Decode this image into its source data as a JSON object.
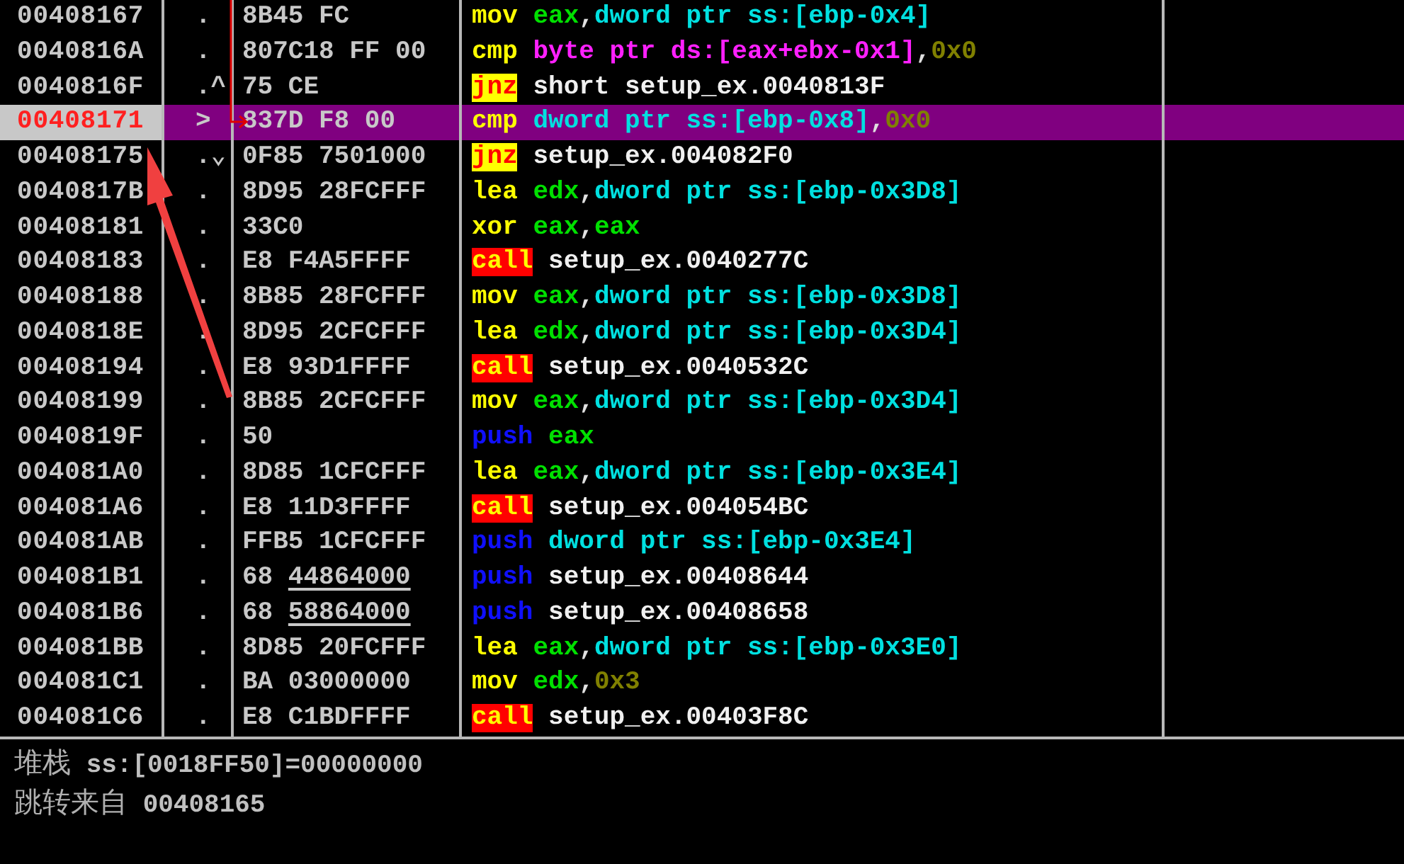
{
  "disassembly": {
    "rows": [
      {
        "address": "00408167",
        "marker": ".",
        "hex": "8B45 FC",
        "selected": false,
        "tokens": [
          {
            "kind": "mnemonic",
            "text": "mov"
          },
          {
            "kind": "register",
            "text": "eax"
          },
          {
            "kind": "punct",
            "text": ","
          },
          {
            "kind": "memory",
            "text": "dword ptr ss:[ebp-0x4]"
          }
        ]
      },
      {
        "address": "0040816A",
        "marker": ".",
        "hex": "807C18 FF 00",
        "selected": false,
        "tokens": [
          {
            "kind": "mnemonic",
            "text": "cmp"
          },
          {
            "kind": "memory-byte",
            "text": "byte ptr ds:[eax+ebx-0x1]"
          },
          {
            "kind": "punct",
            "text": ","
          },
          {
            "kind": "immediate",
            "text": "0x0"
          }
        ]
      },
      {
        "address": "0040816F",
        "marker": ".^",
        "hex": "75 CE",
        "selected": false,
        "tokens": [
          {
            "kind": "jump",
            "text": "jnz"
          },
          {
            "kind": "label",
            "text": "short setup_ex.0040813F"
          }
        ]
      },
      {
        "address": "00408171",
        "marker": ">",
        "hex": "837D F8 00",
        "selected": true,
        "tokens": [
          {
            "kind": "mnemonic",
            "text": "cmp"
          },
          {
            "kind": "memory",
            "text": "dword ptr ss:[ebp-0x8]"
          },
          {
            "kind": "punct",
            "text": ","
          },
          {
            "kind": "immediate",
            "text": "0x0"
          }
        ]
      },
      {
        "address": "00408175",
        "marker": ".⌄",
        "hex": "0F85 7501000",
        "selected": false,
        "tokens": [
          {
            "kind": "jump",
            "text": "jnz"
          },
          {
            "kind": "label",
            "text": "setup_ex.004082F0"
          }
        ]
      },
      {
        "address": "0040817B",
        "marker": ".",
        "hex": "8D95 28FCFFF",
        "selected": false,
        "tokens": [
          {
            "kind": "mnemonic",
            "text": "lea"
          },
          {
            "kind": "register",
            "text": "edx"
          },
          {
            "kind": "punct",
            "text": ","
          },
          {
            "kind": "memory",
            "text": "dword ptr ss:[ebp-0x3D8]"
          }
        ]
      },
      {
        "address": "00408181",
        "marker": ".",
        "hex": "33C0",
        "selected": false,
        "tokens": [
          {
            "kind": "mnemonic",
            "text": "xor"
          },
          {
            "kind": "register",
            "text": "eax"
          },
          {
            "kind": "punct",
            "text": ","
          },
          {
            "kind": "register",
            "text": "eax"
          }
        ]
      },
      {
        "address": "00408183",
        "marker": ".",
        "hex": "E8 F4A5FFFF",
        "selected": false,
        "tokens": [
          {
            "kind": "call",
            "text": "call"
          },
          {
            "kind": "label",
            "text": "setup_ex.0040277C"
          }
        ]
      },
      {
        "address": "00408188",
        "marker": ".",
        "hex": "8B85 28FCFFF",
        "selected": false,
        "tokens": [
          {
            "kind": "mnemonic",
            "text": "mov"
          },
          {
            "kind": "register",
            "text": "eax"
          },
          {
            "kind": "punct",
            "text": ","
          },
          {
            "kind": "memory",
            "text": "dword ptr ss:[ebp-0x3D8]"
          }
        ]
      },
      {
        "address": "0040818E",
        "marker": ".",
        "hex": "8D95 2CFCFFF",
        "selected": false,
        "tokens": [
          {
            "kind": "mnemonic",
            "text": "lea"
          },
          {
            "kind": "register",
            "text": "edx"
          },
          {
            "kind": "punct",
            "text": ","
          },
          {
            "kind": "memory",
            "text": "dword ptr ss:[ebp-0x3D4]"
          }
        ]
      },
      {
        "address": "00408194",
        "marker": ".",
        "hex": "E8 93D1FFFF",
        "selected": false,
        "tokens": [
          {
            "kind": "call",
            "text": "call"
          },
          {
            "kind": "label",
            "text": "setup_ex.0040532C"
          }
        ]
      },
      {
        "address": "00408199",
        "marker": ".",
        "hex": "8B85 2CFCFFF",
        "selected": false,
        "tokens": [
          {
            "kind": "mnemonic",
            "text": "mov"
          },
          {
            "kind": "register",
            "text": "eax"
          },
          {
            "kind": "punct",
            "text": ","
          },
          {
            "kind": "memory",
            "text": "dword ptr ss:[ebp-0x3D4]"
          }
        ]
      },
      {
        "address": "0040819F",
        "marker": ".",
        "hex": "50",
        "selected": false,
        "tokens": [
          {
            "kind": "push",
            "text": "push"
          },
          {
            "kind": "register",
            "text": "eax"
          }
        ]
      },
      {
        "address": "004081A0",
        "marker": ".",
        "hex": "8D85 1CFCFFF",
        "selected": false,
        "tokens": [
          {
            "kind": "mnemonic",
            "text": "lea"
          },
          {
            "kind": "register",
            "text": "eax"
          },
          {
            "kind": "punct",
            "text": ","
          },
          {
            "kind": "memory",
            "text": "dword ptr ss:[ebp-0x3E4]"
          }
        ]
      },
      {
        "address": "004081A6",
        "marker": ".",
        "hex": "E8 11D3FFFF",
        "selected": false,
        "tokens": [
          {
            "kind": "call",
            "text": "call"
          },
          {
            "kind": "label",
            "text": "setup_ex.004054BC"
          }
        ]
      },
      {
        "address": "004081AB",
        "marker": ".",
        "hex": "FFB5 1CFCFFF",
        "selected": false,
        "tokens": [
          {
            "kind": "push",
            "text": "push"
          },
          {
            "kind": "memory",
            "text": "dword ptr ss:[ebp-0x3E4]"
          }
        ]
      },
      {
        "address": "004081B1",
        "marker": ".",
        "hex": "68",
        "hex_operand": "44864000",
        "selected": false,
        "tokens": [
          {
            "kind": "push",
            "text": "push"
          },
          {
            "kind": "label",
            "text": "setup_ex.00408644"
          }
        ]
      },
      {
        "address": "004081B6",
        "marker": ".",
        "hex": "68",
        "hex_operand": "58864000",
        "selected": false,
        "tokens": [
          {
            "kind": "push",
            "text": "push"
          },
          {
            "kind": "label",
            "text": "setup_ex.00408658"
          }
        ]
      },
      {
        "address": "004081BB",
        "marker": ".",
        "hex": "8D85 20FCFFF",
        "selected": false,
        "tokens": [
          {
            "kind": "mnemonic",
            "text": "lea"
          },
          {
            "kind": "register",
            "text": "eax"
          },
          {
            "kind": "punct",
            "text": ","
          },
          {
            "kind": "memory",
            "text": "dword ptr ss:[ebp-0x3E0]"
          }
        ]
      },
      {
        "address": "004081C1",
        "marker": ".",
        "hex": "BA 03000000",
        "selected": false,
        "tokens": [
          {
            "kind": "mnemonic",
            "text": "mov"
          },
          {
            "kind": "register",
            "text": "edx"
          },
          {
            "kind": "punct",
            "text": ","
          },
          {
            "kind": "immediate",
            "text": "0x3"
          }
        ]
      },
      {
        "address": "004081C6",
        "marker": ".",
        "hex": "E8 C1BDFFFF",
        "selected": false,
        "tokens": [
          {
            "kind": "call",
            "text": "call"
          },
          {
            "kind": "label",
            "text": "setup_ex.00403F8C"
          }
        ]
      }
    ]
  },
  "info_pane": {
    "lines": [
      {
        "label": "堆栈",
        "value": "ss:[0018FF50]=00000000"
      },
      {
        "label": "跳转来自",
        "value": "00408165"
      }
    ]
  }
}
